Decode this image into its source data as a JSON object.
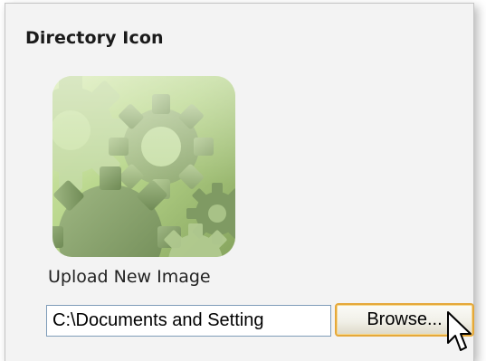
{
  "section": {
    "title": "Directory Icon"
  },
  "icon": {
    "name": "gears-icon",
    "colors": {
      "background_light": "#cfe6a6",
      "background_dark": "#8fae68",
      "gear_light": "#bfd6a0",
      "gear_mid": "#9db77c",
      "gear_dark": "#7a9560"
    }
  },
  "upload": {
    "label": "Upload New Image",
    "file_path_value": "C:\\Documents and Setting",
    "browse_label": "Browse..."
  },
  "colors": {
    "panel_bg": "#f3f3f3",
    "input_border": "#7f9db9",
    "button_border_hover": "#e5a83a"
  }
}
